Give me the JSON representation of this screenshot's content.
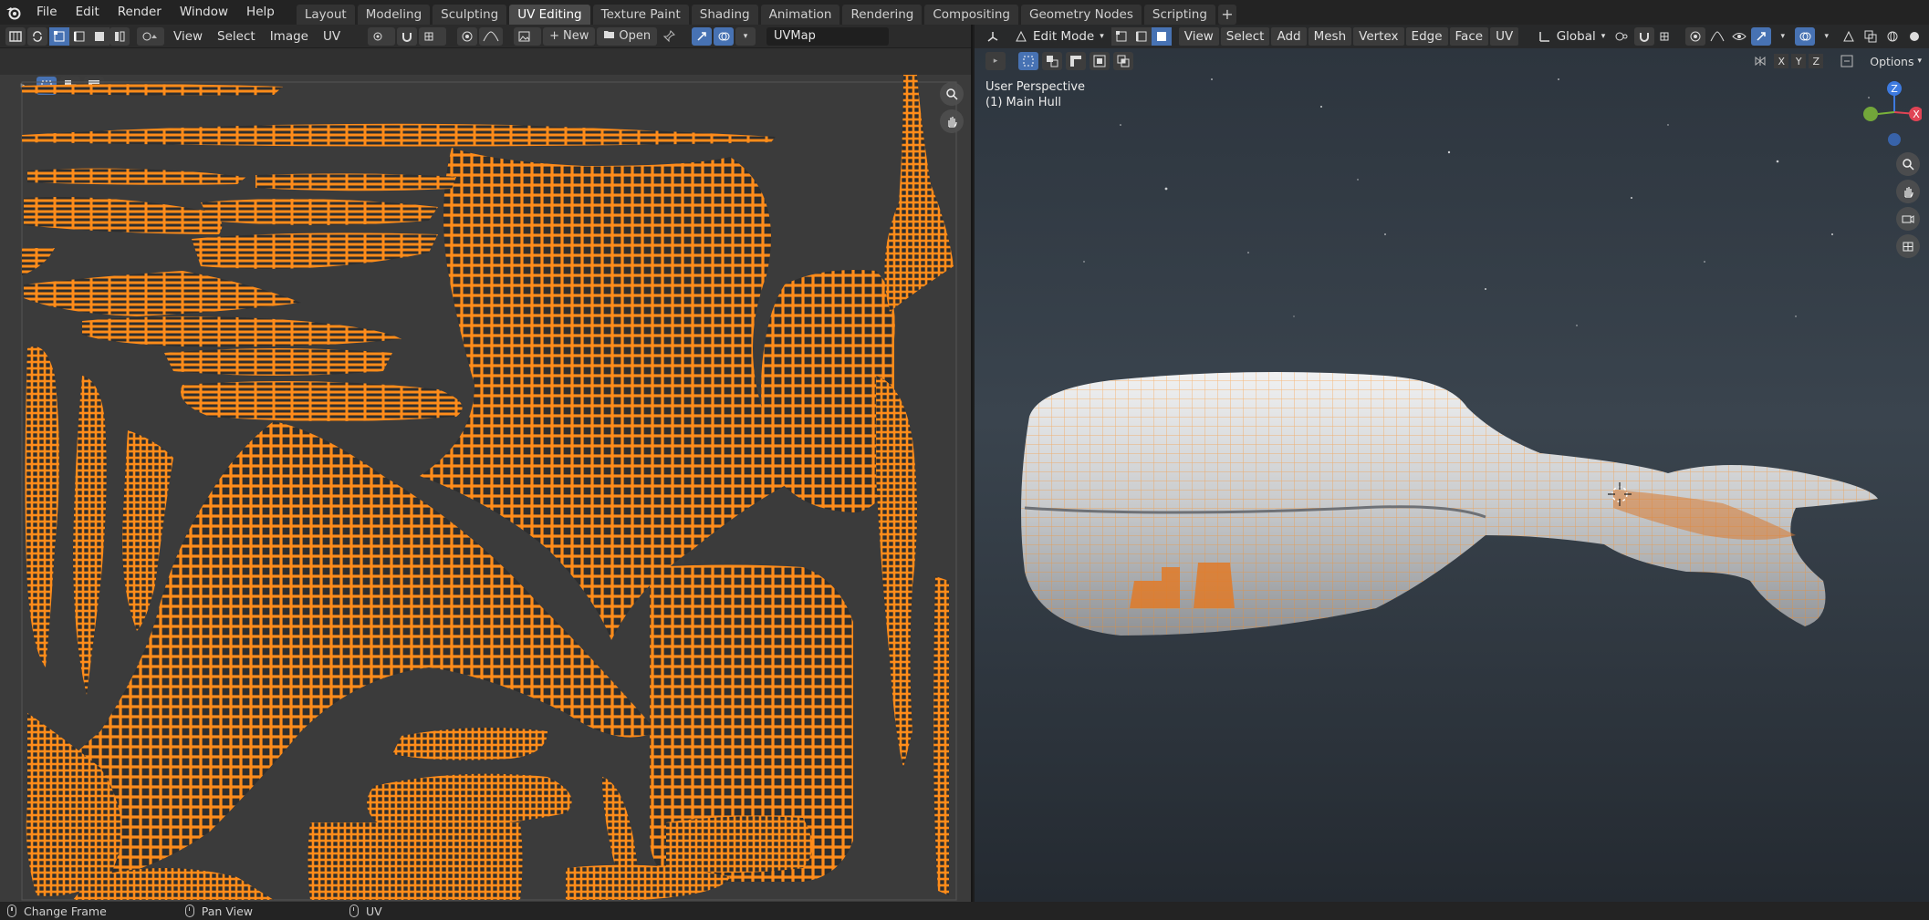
{
  "topbar": {
    "menus": [
      "File",
      "Edit",
      "Render",
      "Window",
      "Help"
    ],
    "workspaces": [
      "Layout",
      "Modeling",
      "Sculpting",
      "UV Editing",
      "Texture Paint",
      "Shading",
      "Animation",
      "Rendering",
      "Compositing",
      "Geometry Nodes",
      "Scripting"
    ],
    "active_workspace": "UV Editing",
    "add_tab_icon": "plus-icon"
  },
  "uv_editor": {
    "menus": [
      "View",
      "Select",
      "Image",
      "UV"
    ],
    "new_label": "New",
    "open_label": "Open",
    "uv_map_value": "UVMap",
    "colors": {
      "uv_edges": "#ff8c1a",
      "background": "#3b3b3b"
    }
  },
  "viewport": {
    "mode_label": "Edit Mode",
    "menus": [
      "View",
      "Select",
      "Add",
      "Mesh",
      "Vertex",
      "Edge",
      "Face",
      "UV"
    ],
    "transform_orientation": "Global",
    "perspective_label": "User Perspective",
    "object_label": "(1) Main Hull",
    "axis_buttons": [
      "X",
      "Y",
      "Z"
    ],
    "options_label": "Options",
    "gizmo_labels": {
      "z": "Z",
      "x": "X"
    },
    "colors": {
      "x_axis": "#e04455",
      "y_axis": "#7ab23a",
      "z_axis": "#3d7ae0",
      "ship_hull": "#d8dadc"
    }
  },
  "statusbar": {
    "items": [
      "Change Frame",
      "Pan View",
      "UV"
    ]
  }
}
